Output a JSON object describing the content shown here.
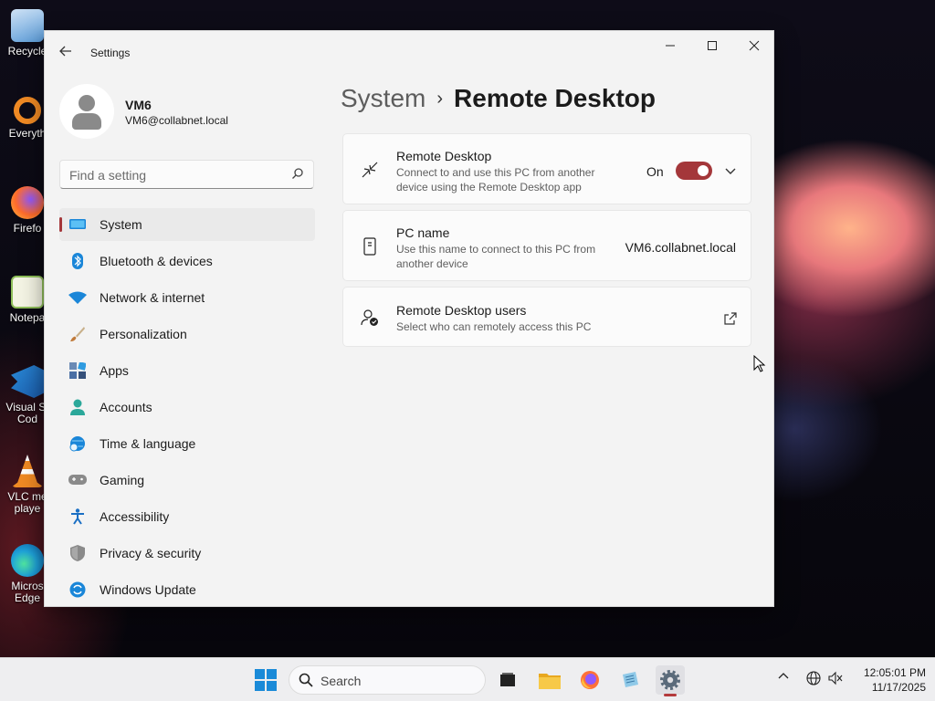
{
  "desktop": {
    "icons": [
      {
        "label": "Recycle",
        "icon": "recycle-bin-icon",
        "color": "#5a9bd8"
      },
      {
        "label": "Everyth",
        "icon": "everything-search-icon",
        "color": "#f08a24"
      },
      {
        "label": "Firefo",
        "icon": "firefox-icon",
        "color": "#ff6b2b"
      },
      {
        "label": "Notepa",
        "icon": "notepad-icon",
        "color": "#8fbf5a"
      },
      {
        "label": "Visual St",
        "label2": "Cod",
        "icon": "vscode-icon",
        "color": "#2a8ad8"
      },
      {
        "label": "VLC me",
        "label2": "playe",
        "icon": "vlc-icon",
        "color": "#f08a24"
      },
      {
        "label": "Micros",
        "label2": "Edge",
        "icon": "edge-icon",
        "color": "#1fa3d9"
      }
    ]
  },
  "window": {
    "title": "Settings",
    "back_label": "←",
    "minimize": "—",
    "maximize": "☐",
    "close": "✕"
  },
  "profile": {
    "name": "VM6",
    "email": "VM6@collabnet.local"
  },
  "search": {
    "placeholder": "Find a setting",
    "value": ""
  },
  "nav": {
    "items": [
      {
        "label": "System",
        "icon": "system-display-icon",
        "active": true,
        "color": "#0078d4"
      },
      {
        "label": "Bluetooth & devices",
        "icon": "bluetooth-icon",
        "color": "#0078d4"
      },
      {
        "label": "Network & internet",
        "icon": "wifi-icon",
        "color": "#0078d4"
      },
      {
        "label": "Personalization",
        "icon": "paintbrush-icon",
        "color": "#c07a3a"
      },
      {
        "label": "Apps",
        "icon": "apps-icon",
        "color": "#4a6fa5"
      },
      {
        "label": "Accounts",
        "icon": "accounts-icon",
        "color": "#2ba89a"
      },
      {
        "label": "Time & language",
        "icon": "globe-clock-icon",
        "color": "#1a8ad4"
      },
      {
        "label": "Gaming",
        "icon": "gamepad-icon",
        "color": "#7a7a7a"
      },
      {
        "label": "Accessibility",
        "icon": "accessibility-icon",
        "color": "#1a6fc4"
      },
      {
        "label": "Privacy & security",
        "icon": "shield-icon",
        "color": "#7a7a7a"
      },
      {
        "label": "Windows Update",
        "icon": "update-icon",
        "color": "#1a8ad4"
      }
    ]
  },
  "breadcrumb": {
    "parent": "System",
    "separator": "›",
    "current": "Remote Desktop"
  },
  "cards": {
    "remote_desktop": {
      "title": "Remote Desktop",
      "description": "Connect to and use this PC from another device using the Remote Desktop app",
      "toggle_label": "On",
      "toggle_on": true
    },
    "pc_name": {
      "title": "PC name",
      "description": "Use this name to connect to this PC from another device",
      "value": "VM6.collabnet.local"
    },
    "users": {
      "title": "Remote Desktop users",
      "description": "Select who can remotely access this PC"
    }
  },
  "taskbar": {
    "search_label": "Search",
    "apps": [
      "task-view-icon",
      "file-explorer-icon",
      "firefox-icon",
      "notepad-app-icon",
      "settings-gear-icon"
    ],
    "time": "12:05:01 PM",
    "date": "11/17/2025"
  },
  "colors": {
    "accent": "#a4373a",
    "window_bg": "#f3f3f3",
    "card_bg": "#fbfbfb"
  }
}
